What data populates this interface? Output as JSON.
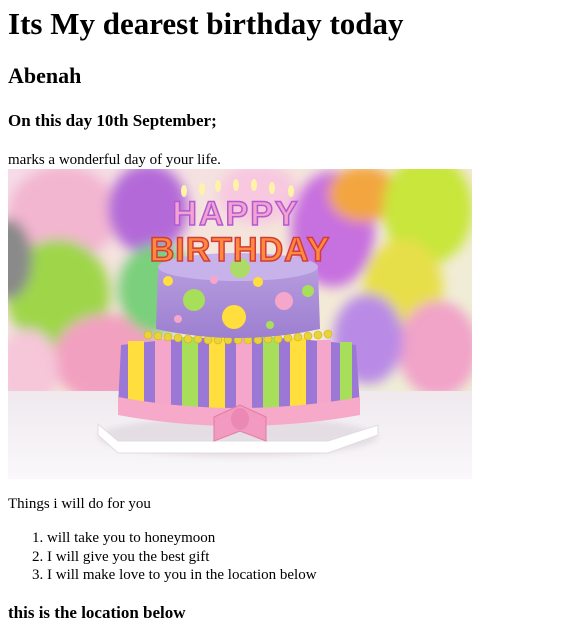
{
  "page": {
    "title": "Its My dearest birthday today",
    "name": "Abenah",
    "date_heading": "On this day 10th September;",
    "intro": "marks a wonderful day of your life.",
    "image": {
      "icon": "birthday-cake-icon",
      "topper_top": "HAPPY",
      "topper_bottom": "BIRTHDAY"
    },
    "list_intro": "Things i will do for you",
    "list": [
      "will take you to honeymoon",
      "I will give you the best gift",
      "I will make love to you in the location below"
    ],
    "location_heading": "this is the location below"
  },
  "colors": {
    "text": "#000000",
    "background": "#ffffff"
  }
}
